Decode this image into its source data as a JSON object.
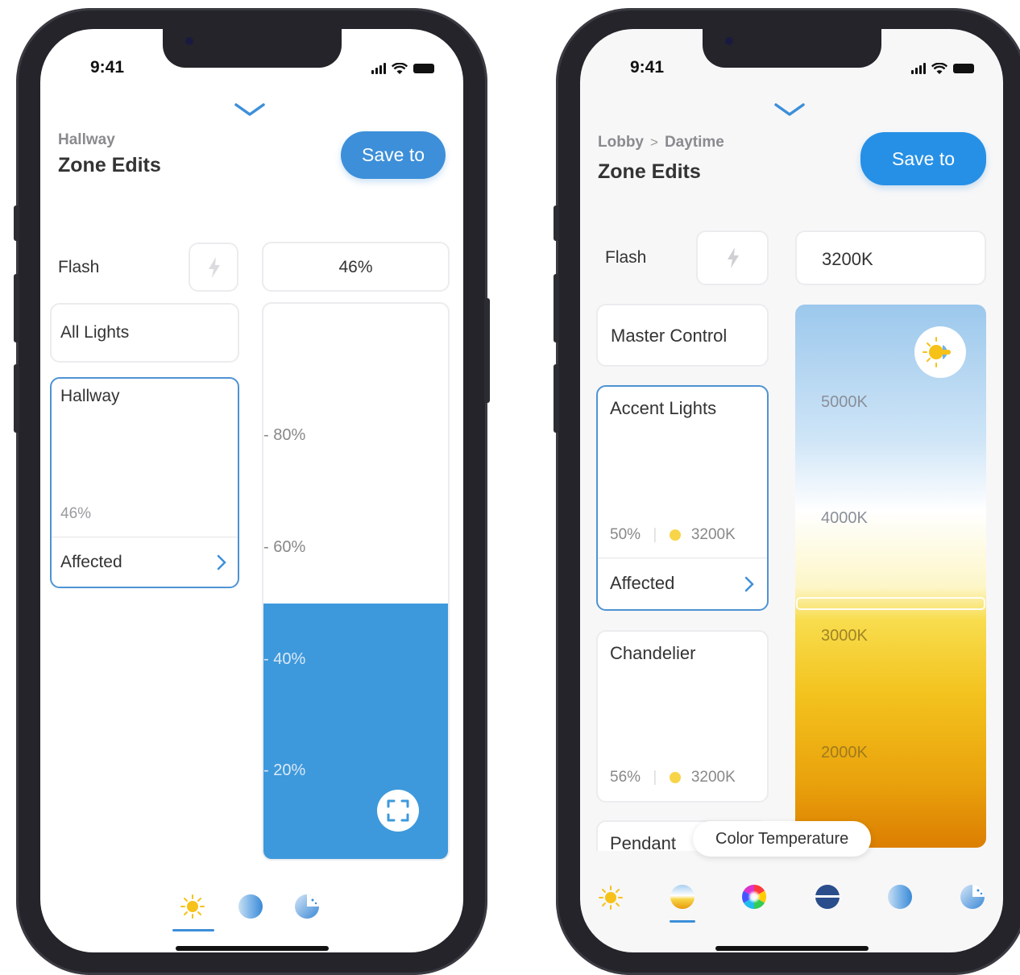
{
  "status_bar": {
    "time": "9:41"
  },
  "left_screen": {
    "breadcrumb": "Hallway",
    "title": "Zone Edits",
    "save_label": "Save to",
    "flash_label": "Flash",
    "level_value": "46%",
    "level_fraction": 0.46,
    "zones": [
      {
        "name": "All Lights"
      },
      {
        "name": "Hallway",
        "level": "46%",
        "affected_label": "Affected",
        "selected": true
      }
    ],
    "scale_ticks": [
      "80%",
      "60%",
      "40%",
      "20%"
    ],
    "tabs": [
      "sun-icon",
      "half-moon-icon",
      "dim-moon-icon"
    ],
    "accent_color": "#3d99dc"
  },
  "right_screen": {
    "breadcrumb": [
      "Lobby",
      "Daytime"
    ],
    "title": "Zone Edits",
    "save_label": "Save to",
    "flash_label": "Flash",
    "temperature_value": "3200K",
    "zones": [
      {
        "name": "Master Control"
      },
      {
        "name": "Accent Lights",
        "level": "50%",
        "temp": "3200K",
        "affected_label": "Affected",
        "selected": true
      },
      {
        "name": "Chandelier",
        "level": "56%",
        "temp": "3200K"
      },
      {
        "name": "Pendant"
      }
    ],
    "scale_ticks": [
      "5000K",
      "4000K",
      "3000K",
      "2000K"
    ],
    "tooltip": "Color Temperature",
    "tabs": [
      "sun-icon",
      "color-temperature-icon",
      "color-wheel-icon",
      "horizon-icon",
      "half-moon-icon",
      "dim-moon-icon"
    ]
  }
}
